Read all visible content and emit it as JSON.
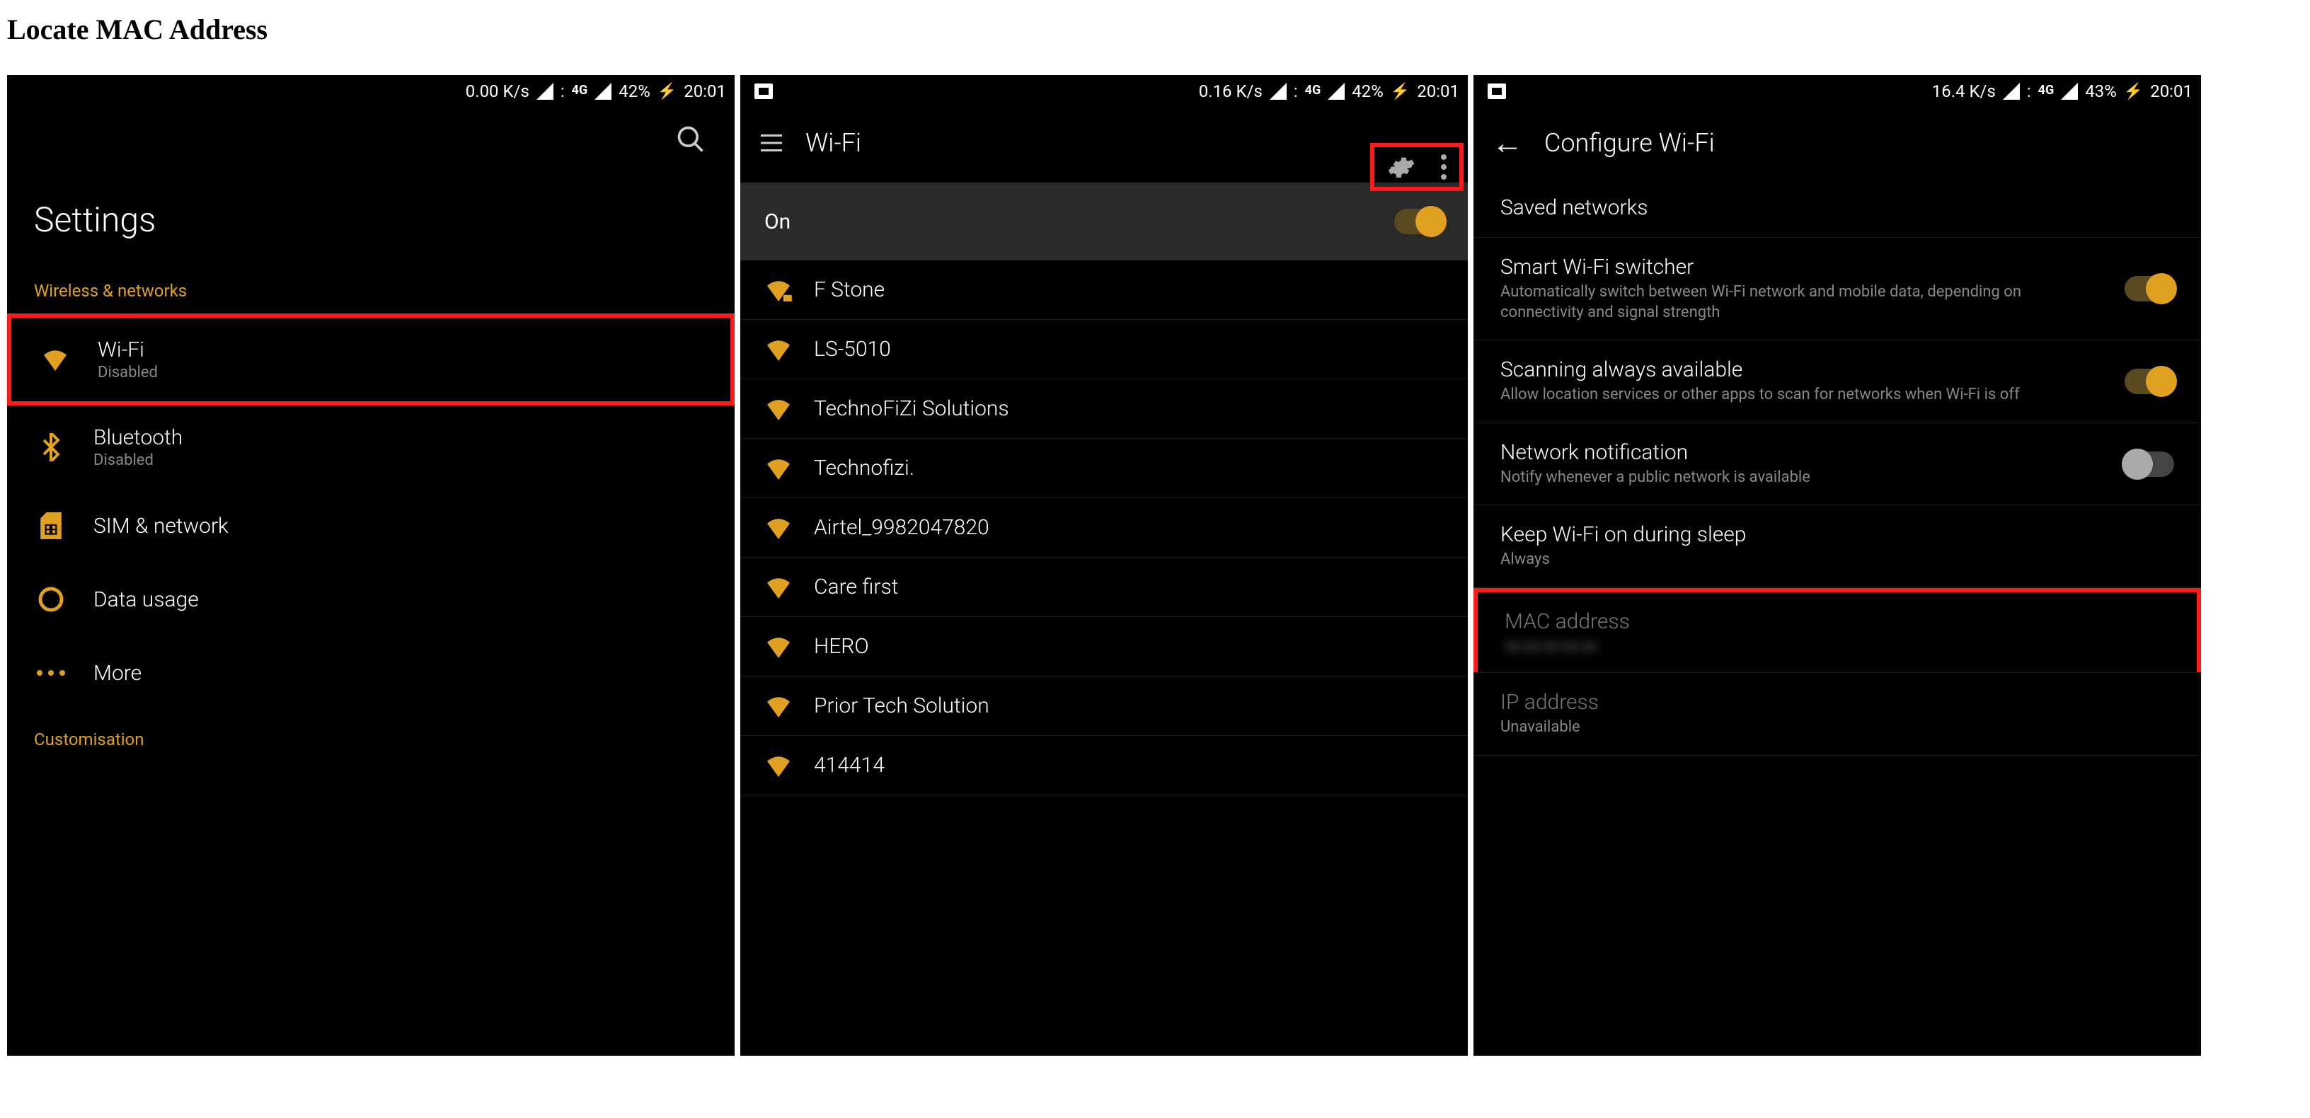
{
  "heading": "Locate MAC Address",
  "colors": {
    "accent": "#e0a020",
    "highlight": "#ff1a1a"
  },
  "phone1": {
    "status": {
      "speed": "0.00 K/s",
      "net": "4G",
      "battery": "42%",
      "time": "20:01"
    },
    "title": "Settings",
    "section1": "Wireless & networks",
    "items": [
      {
        "title": "Wi-Fi",
        "sub": "Disabled",
        "icon": "wifi-icon",
        "highlight": true
      },
      {
        "title": "Bluetooth",
        "sub": "Disabled",
        "icon": "bluetooth-icon"
      },
      {
        "title": "SIM & network",
        "sub": "",
        "icon": "sim-icon"
      },
      {
        "title": "Data usage",
        "sub": "",
        "icon": "data-usage-icon"
      },
      {
        "title": "More",
        "sub": "",
        "icon": "more-icon"
      }
    ],
    "section2": "Customisation"
  },
  "phone2": {
    "status": {
      "speed": "0.16 K/s",
      "net": "4G",
      "battery": "42%",
      "time": "20:01"
    },
    "title": "Wi-Fi",
    "on_label": "On",
    "toggle": true,
    "networks": [
      "F Stone",
      "LS-5010",
      "TechnoFiZi Solutions",
      "Technofizi.",
      "Airtel_9982047820",
      "Care first",
      "HERO",
      "Prior Tech Solution",
      "414414"
    ]
  },
  "phone3": {
    "status": {
      "speed": "16.4 K/s",
      "net": "4G",
      "battery": "43%",
      "time": "20:01"
    },
    "title": "Configure Wi-Fi",
    "rows": [
      {
        "title": "Saved networks",
        "sub": ""
      },
      {
        "title": "Smart Wi-Fi switcher",
        "sub": "Automatically switch between Wi-Fi network and mobile data, depending on connectivity and signal strength",
        "toggle": "on"
      },
      {
        "title": "Scanning always available",
        "sub": "Allow location services or other apps to scan for networks when Wi-Fi is off",
        "toggle": "on"
      },
      {
        "title": "Network notification",
        "sub": "Notify whenever a public network is available",
        "toggle": "off"
      },
      {
        "title": "Keep Wi-Fi on during sleep",
        "sub": "Always"
      },
      {
        "title": "MAC address",
        "sub": "",
        "blurred": true,
        "highlight": true,
        "dim": true
      },
      {
        "title": "IP address",
        "sub": "Unavailable",
        "dim": true
      }
    ]
  }
}
